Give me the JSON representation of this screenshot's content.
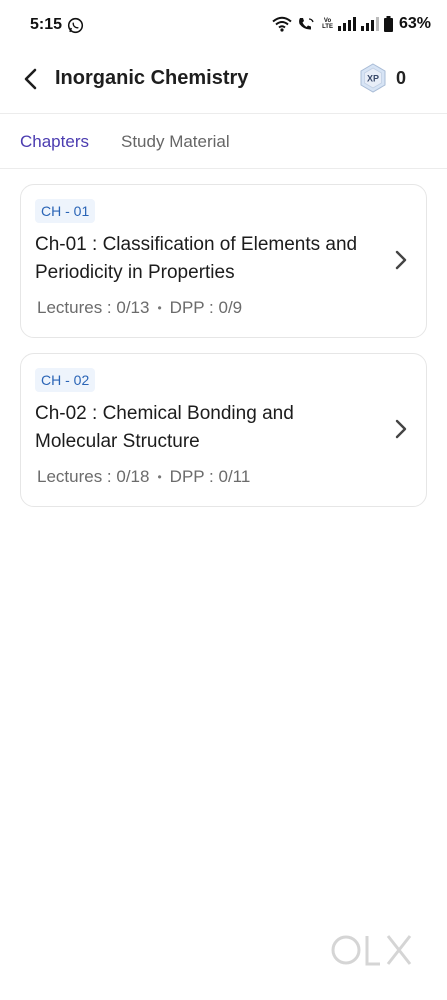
{
  "status_bar": {
    "time": "5:15",
    "volte_line1": "Vo",
    "volte_line2": "LTE",
    "battery_percent": "63%"
  },
  "header": {
    "title": "Inorganic Chemistry",
    "xp_label": "XP",
    "xp_count": "0"
  },
  "tabs": [
    {
      "label": "Chapters",
      "active": true
    },
    {
      "label": "Study Material",
      "active": false
    }
  ],
  "chapters": [
    {
      "chip": "CH - 01",
      "title": "Ch-01 : Classification of Elements and Periodicity in Properties",
      "lectures": "Lectures : 0/13",
      "dpp": "DPP : 0/9"
    },
    {
      "chip": "CH - 02",
      "title": "Ch-02 : Chemical Bonding and Molecular Structure",
      "lectures": "Lectures : 0/18",
      "dpp": "DPP : 0/11"
    }
  ],
  "meta_separator": "•",
  "colors": {
    "accent": "#4b3cb0",
    "chip_text": "#2a64b6",
    "chip_bg": "#eef4fc"
  },
  "icons": {
    "back": "arrow-left-icon",
    "xp": "xp-badge-icon",
    "chevron": "chevron-right-icon",
    "whatsapp": "whatsapp-icon",
    "wifi": "wifi-icon",
    "call": "wifi-call-icon",
    "signal": "signal-icon",
    "battery": "battery-icon"
  },
  "watermark": {
    "logo_text": "OLX"
  }
}
